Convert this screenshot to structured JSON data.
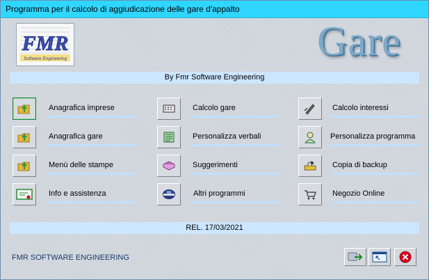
{
  "window": {
    "title": "Programma per il calcolo di aggiudicazione delle gare d'appalto"
  },
  "logo": {
    "letters": "FMR",
    "tagline": "Software Engineering"
  },
  "app_title": "Gare",
  "header_band": "By Fmr Software Engineering",
  "menu": {
    "col1": [
      {
        "label": "Anagrafica imprese",
        "icon": "folder-arrow-icon"
      },
      {
        "label": "Anagrafica gare",
        "icon": "folder-arrow-icon"
      },
      {
        "label": "Menù delle stampe",
        "icon": "folder-arrow-icon"
      },
      {
        "label": "Info e assistenza",
        "icon": "certificate-icon"
      }
    ],
    "col2": [
      {
        "label": "Calcolo gare",
        "icon": "calculator-icon"
      },
      {
        "label": "Personalizza verbali",
        "icon": "document-icon"
      },
      {
        "label": "Suggerimenti",
        "icon": "book-icon"
      },
      {
        "label": "Altri programmi",
        "icon": "disk-icon"
      }
    ],
    "col3": [
      {
        "label": "Calcolo interessi",
        "icon": "pen-icon"
      },
      {
        "label": "Personalizza programma",
        "icon": "user-icon"
      },
      {
        "label": "Copia di backup",
        "icon": "backup-icon"
      },
      {
        "label": "Negozio Online",
        "icon": "cart-icon"
      }
    ]
  },
  "release_band": "REL. 17/03/2021",
  "footer": "FMR SOFTWARE ENGINEERING",
  "bottom_buttons": [
    {
      "icon": "exit-arrow-icon"
    },
    {
      "icon": "window-icon"
    },
    {
      "icon": "close-icon"
    }
  ],
  "colors": {
    "titlebar": "#2fd6ff",
    "band": "#cde6ff",
    "accent_green": "#1b7f3a",
    "close_red": "#d9001b"
  }
}
